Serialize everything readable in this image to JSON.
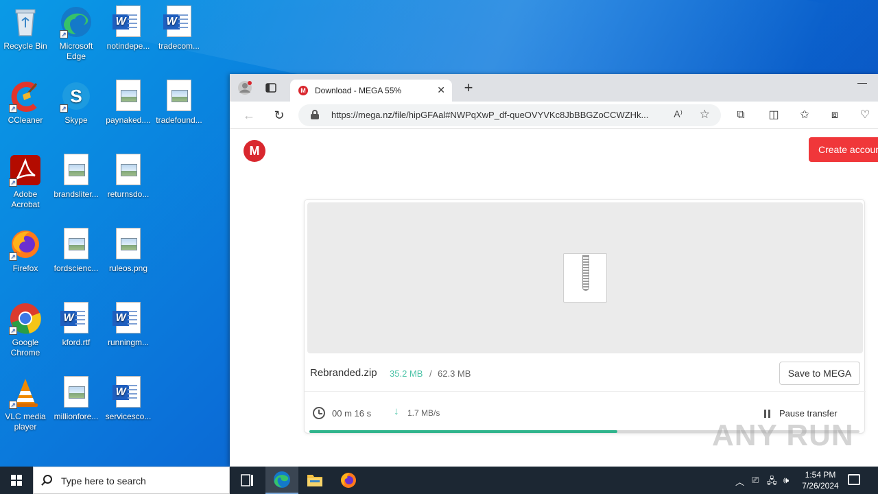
{
  "desktop": {
    "icons": [
      {
        "label": "Recycle Bin",
        "icon": "recycle-bin-icon"
      },
      {
        "label": "Microsoft Edge",
        "icon": "edge-icon"
      },
      {
        "label": "notindepe...",
        "icon": "word-doc-icon"
      },
      {
        "label": "tradecom...",
        "icon": "word-doc-icon"
      },
      {
        "label": "CCleaner",
        "icon": "ccleaner-icon"
      },
      {
        "label": "Skype",
        "icon": "skype-icon"
      },
      {
        "label": "paynaked....",
        "icon": "image-file-icon"
      },
      {
        "label": "tradefound...",
        "icon": "image-file-icon"
      },
      {
        "label": "Adobe Acrobat",
        "icon": "acrobat-icon"
      },
      {
        "label": "brandsliter...",
        "icon": "image-file-icon"
      },
      {
        "label": "returnsdo...",
        "icon": "image-file-icon"
      },
      {
        "label": "Firefox",
        "icon": "firefox-icon"
      },
      {
        "label": "fordscienc...",
        "icon": "image-file-icon"
      },
      {
        "label": "ruleos.png",
        "icon": "image-file-icon"
      },
      {
        "label": "Google Chrome",
        "icon": "chrome-icon"
      },
      {
        "label": "kford.rtf",
        "icon": "word-doc-icon"
      },
      {
        "label": "runningm...",
        "icon": "word-doc-icon"
      },
      {
        "label": "VLC media player",
        "icon": "vlc-icon"
      },
      {
        "label": "millionfore...",
        "icon": "image-file-icon"
      },
      {
        "label": "servicesco...",
        "icon": "word-doc-icon"
      }
    ]
  },
  "browser": {
    "tab_title": "Download - MEGA 55%",
    "tab_favicon": "M",
    "new_tab_label": "+",
    "url": "https://mega.nz/file/hipGFAal#NWPqXwP_df-queOVYVKc8JbBBGZoCCWZHk...",
    "read_aloud": "A)",
    "minimize": "—"
  },
  "page": {
    "logo": "M",
    "create_account": "Create account",
    "file_name": "Rebranded.zip",
    "downloaded_size": "35.2 MB",
    "separator": "/",
    "total_size": "62.3 MB",
    "save_button": "Save to MEGA",
    "time_left": "00 m  16 s",
    "speed": "1.7 MB/s",
    "pause_label": "Pause transfer",
    "progress": 0.56
  },
  "watermark": "ANY RUN",
  "taskbar": {
    "search_placeholder": "Type here to search",
    "time": "1:54 PM",
    "date": "7/26/2024"
  },
  "colors": {
    "mega_red": "#d9272e",
    "accent_green": "#4bc3a7",
    "progress_green": "#2fb48c"
  }
}
